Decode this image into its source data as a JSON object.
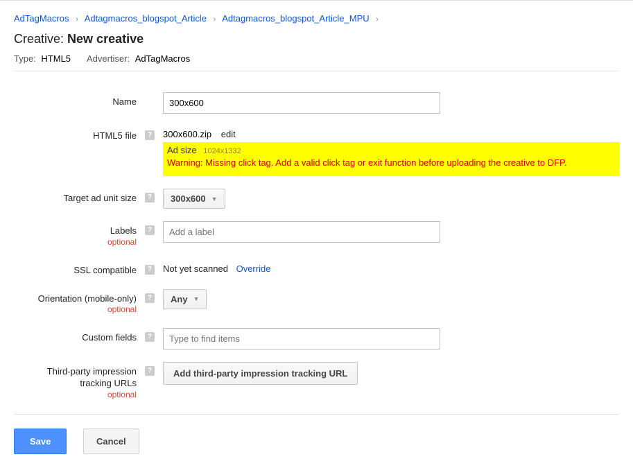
{
  "breadcrumb": {
    "item1": "AdTagMacros",
    "item2": "Adtagmacros_blogspot_Article",
    "item3": "Adtagmacros_blogspot_Article_MPU"
  },
  "title": {
    "prefix": "Creative:",
    "name": "New creative"
  },
  "meta": {
    "type_label": "Type:",
    "type_value": "HTML5",
    "advertiser_label": "Advertiser:",
    "advertiser_value": "AdTagMacros"
  },
  "labels": {
    "name": "Name",
    "html5_file": "HTML5 file",
    "target_ad_unit": "Target ad unit size",
    "labels_field": "Labels",
    "ssl": "SSL compatible",
    "orientation": "Orientation (mobile-only)",
    "custom_fields": "Custom fields",
    "tracking": "Third-party impression tracking URLs",
    "optional": "optional"
  },
  "fields": {
    "name_value": "300x600",
    "file_name": "300x600.zip",
    "edit_text": "edit",
    "ad_size_label": "Ad size",
    "ad_size_value": "1024x1332",
    "warning_text": "Warning: Missing click tag. Add a valid click tag or exit function before uploading the creative to DFP.",
    "target_dropdown": "300x600",
    "labels_placeholder": "Add a label",
    "ssl_status": "Not yet scanned",
    "override_text": "Override",
    "orientation_dropdown": "Any",
    "custom_placeholder": "Type to find items",
    "tracking_button": "Add third-party impression tracking URL"
  },
  "buttons": {
    "save": "Save",
    "cancel": "Cancel"
  },
  "help_icon": "?"
}
